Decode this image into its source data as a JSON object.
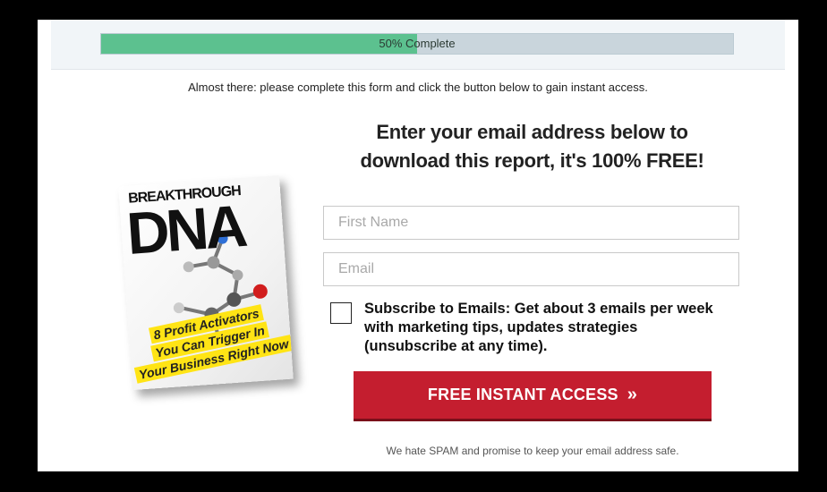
{
  "progress": {
    "label": "50% Complete",
    "percent": 50
  },
  "intro_text": "Almost there: please complete this form and click the button below to gain instant access.",
  "book": {
    "title_small": "BREAKTHROUGH",
    "title_big": "DNA",
    "subtitle_lines": [
      "8 Profit Activators",
      "You Can Trigger In",
      "Your Business Right Now"
    ]
  },
  "headline": {
    "line1": "Enter your email address below to",
    "line2": "download this report, it's 100% FREE!"
  },
  "form": {
    "first_name_placeholder": "First Name",
    "email_placeholder": "Email",
    "first_name_value": "",
    "email_value": "",
    "subscribe_checked": false,
    "subscribe_label": "Subscribe to Emails: Get about 3 emails per week with marketing tips, updates strategies (unsubscribe at any time)."
  },
  "cta": {
    "label": "FREE INSTANT ACCESS",
    "icon": "double-chevron-right-icon",
    "glyph": "»",
    "color": "#c41e2f"
  },
  "spam_note": "We hate SPAM and promise to keep your email address safe."
}
